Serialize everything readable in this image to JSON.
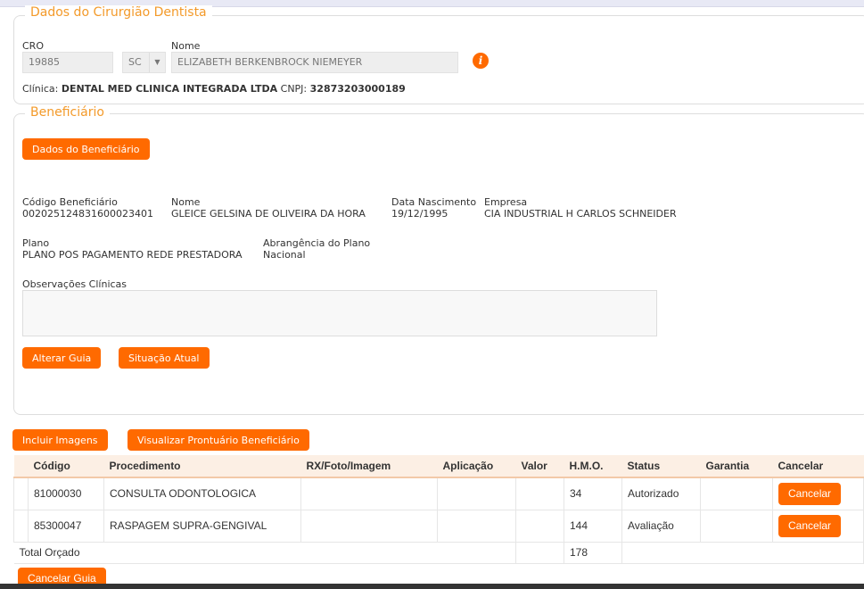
{
  "dentist": {
    "legend": "Dados do Cirurgião Dentista",
    "cro_label": "CRO",
    "cro": "19885",
    "uf": "SC",
    "name_label": "Nome",
    "name": "ELIZABETH BERKENBROCK NIEMEYER",
    "clinic_label": "Clínica:",
    "clinic": "DENTAL MED CLINICA INTEGRADA LTDA",
    "cnpj_label": "CNPJ:",
    "cnpj": "32873203000189"
  },
  "beneficiary": {
    "legend": "Beneficiário",
    "data_button": "Dados do Beneficiário",
    "code_label": "Código Beneficiário",
    "code": "00202512483160002340​1",
    "name_label": "Nome",
    "name": "GLEICE GELSINA DE OLIVEIRA DA HORA",
    "birth_label": "Data Nascimento",
    "birth": "19/12/1995",
    "company_label": "Empresa",
    "company": "CIA INDUSTRIAL H CARLOS SCHNEIDER",
    "plan_label": "Plano",
    "plan": "PLANO POS PAGAMENTO REDE PRESTADORA",
    "coverage_label": "Abrangência do Plano",
    "coverage": "Nacional",
    "obs_label": "Observações Clínicas",
    "alter_button": "Alterar Guia",
    "status_button": "Situação Atual"
  },
  "actions": {
    "images": "Incluir Imagens",
    "records": "Visualizar Prontuário Beneficiário",
    "cancel_guide": "Cancelar Guia"
  },
  "table": {
    "headers": [
      "",
      "Código",
      "Procedimento",
      "RX/Foto/Imagem",
      "Aplicação",
      "Valor",
      "H.M.O.",
      "Status",
      "Garantia",
      "Cancelar"
    ],
    "rows": [
      {
        "code": "81000030",
        "proc": "CONSULTA ODONTOLOGICA",
        "hmo": "34",
        "status": "Autorizado",
        "cancel": "Cancelar"
      },
      {
        "code": "85300047",
        "proc": "RASPAGEM SUPRA-GENGIVAL",
        "hmo": "144",
        "status": "Avaliação",
        "cancel": "Cancelar"
      }
    ],
    "total_label": "Total Orçado",
    "total": "178"
  }
}
